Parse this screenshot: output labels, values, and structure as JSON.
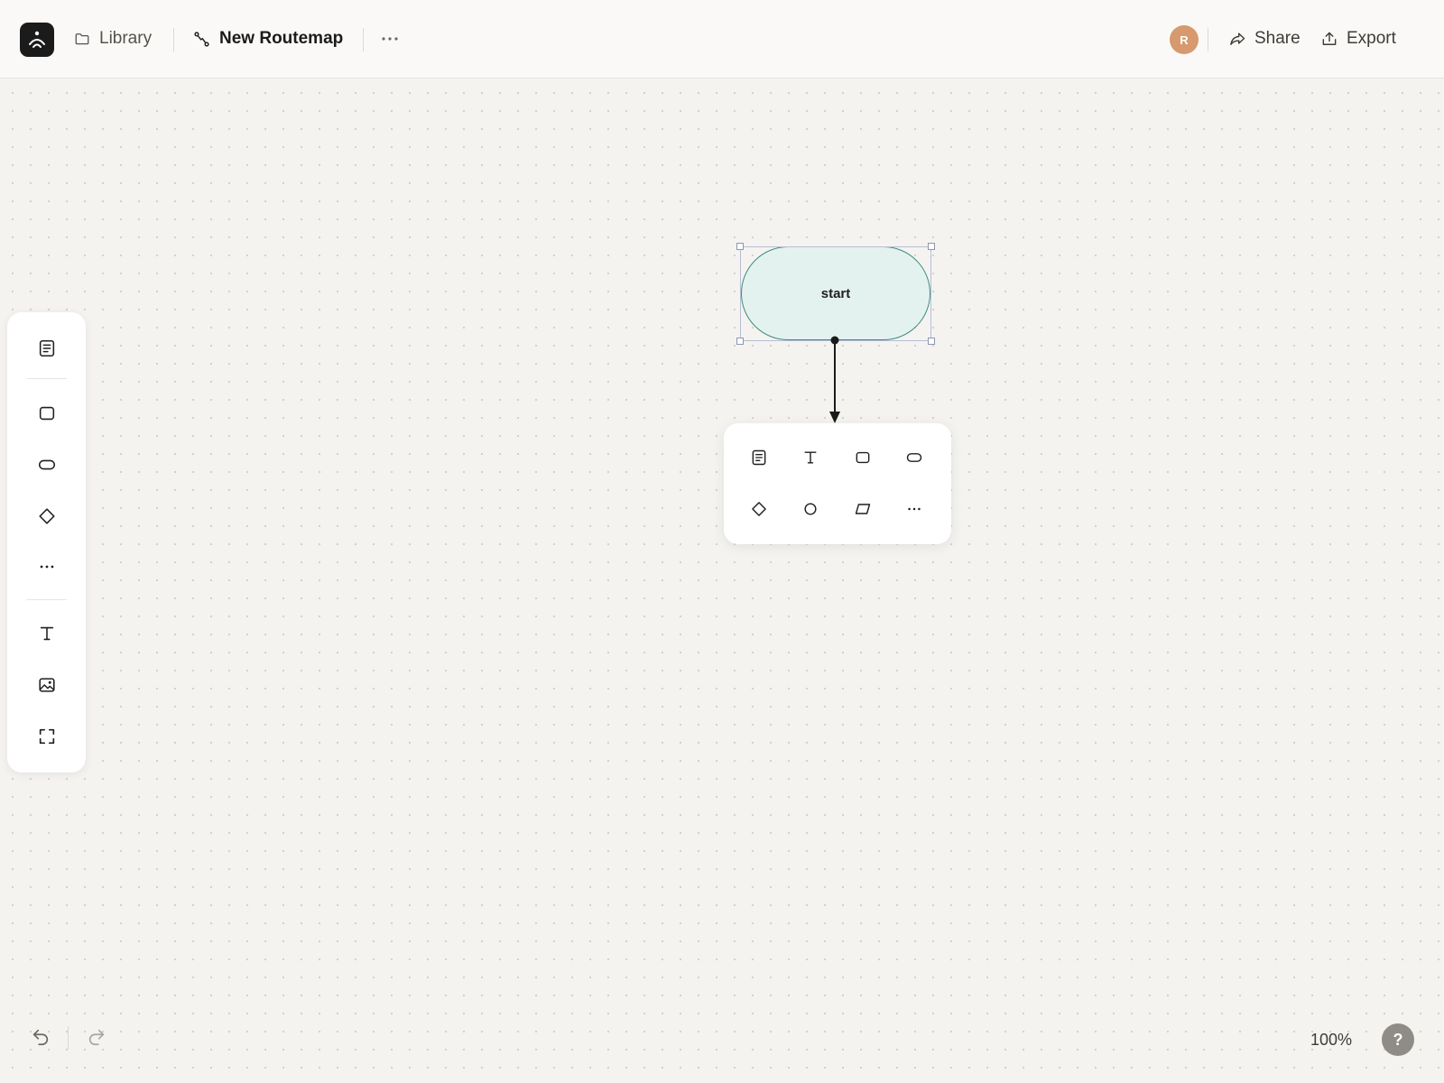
{
  "topbar": {
    "logo_icon": "app-logo-icon",
    "library_label": "Library",
    "document_title": "New Routemap",
    "avatar_initial": "R",
    "share_label": "Share",
    "export_label": "Export"
  },
  "toolbar": {
    "items": [
      {
        "icon": "note-icon"
      },
      {
        "icon": "rectangle-icon"
      },
      {
        "icon": "pill-icon"
      },
      {
        "icon": "diamond-icon"
      },
      {
        "icon": "more-icon"
      },
      {
        "icon": "text-icon"
      },
      {
        "icon": "image-icon"
      },
      {
        "icon": "frame-icon"
      }
    ]
  },
  "diagram": {
    "nodes": [
      {
        "shape": "terminal",
        "label": "start",
        "fill": "#e4f2ef",
        "stroke": "#3d8c7d"
      }
    ]
  },
  "quick_add": {
    "items": [
      {
        "icon": "note-icon"
      },
      {
        "icon": "text-icon"
      },
      {
        "icon": "rectangle-icon"
      },
      {
        "icon": "pill-icon"
      },
      {
        "icon": "diamond-icon"
      },
      {
        "icon": "circle-icon"
      },
      {
        "icon": "parallelogram-icon"
      },
      {
        "icon": "more-icon"
      }
    ]
  },
  "footer": {
    "zoom_label": "100%",
    "help_label": "?"
  },
  "colors": {
    "accent_node_fill": "#e4f2ef",
    "accent_node_stroke": "#3d8c7d",
    "avatar": "#d69a6e",
    "selection": "#8e95b4"
  }
}
